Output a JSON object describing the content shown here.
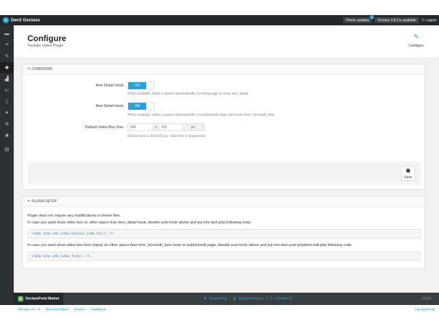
{
  "topbar": {
    "brand": "Dev2 Osclass",
    "theme_updates": "Theme updates",
    "theme_updates_count": "1",
    "version_notice": "Osclass 3.8.0 is available",
    "logout": "Logout"
  },
  "sidebar": {
    "icons": [
      "briefcase-icon",
      "list-icon",
      "brush-icon",
      "puzzle-icon",
      "stats-icon",
      "wrench-icon",
      "document-icon",
      "user-icon",
      "gears-icon",
      "settings-icon",
      "database-icon"
    ]
  },
  "header": {
    "title": "Configure",
    "subtitle": "Youtube Video Plugin",
    "configure_label": "Configure"
  },
  "configure": {
    "heading": "CONFIGURE",
    "rows": [
      {
        "label": "Item Detail Hook",
        "toggle": "ON",
        "hint": "When enabled, video is placed automatically on listing page to hook item_detail."
      },
      {
        "label": "Item Detail Hook",
        "toggle": "ON",
        "hint": "When enabled, video is placed automatically on publish/edit page into hooks item_form/edit_item."
      }
    ],
    "size": {
      "label": "Default Video Box Size",
      "width": "560",
      "separator": "x",
      "height": "315",
      "unit": "px",
      "hint": "Default size is 560x315 px, video box is responsive"
    },
    "save_label": "Save"
  },
  "setup": {
    "heading": "PLUGIN SETUP",
    "line1": "Plugin does not require any modifications in theme files.",
    "line2": "In case you want show video box on other space than item_detail hook, disable auto-hook above and put into item.php following code:",
    "code1": "<?php echo ytb_video_box(osc_item_id()); ?>",
    "line3": "In case you want show video box form (input) on other space than item_form/edit_item hook on publish/edit page, disable auto-hook above and put into item-post.php/item-edit.php following code:",
    "code2": "<?php echo ytb_video_form(); ?>"
  },
  "footer": {
    "market": "OsclassPoint Market",
    "report_bug": "Report Bug",
    "support_forums": "Support Forums",
    "contact_us": "Contact Us",
    "separator": "/",
    "version": "v1.0.0"
  },
  "bottom": {
    "osclass_version": "Osclass v3.7.4",
    "documentation": "Documentation",
    "forums": "Forums",
    "feedback": "Feedback",
    "separator": "·",
    "brand": "OsclassPoint"
  }
}
